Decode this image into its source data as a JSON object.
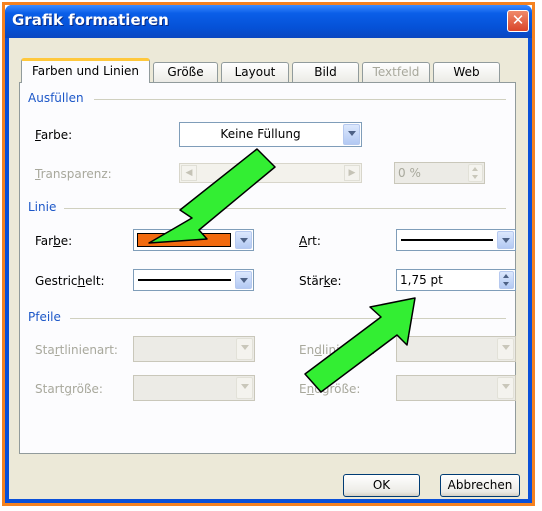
{
  "window": {
    "title": "Grafik formatieren",
    "close_glyph": "✕"
  },
  "tabs": [
    {
      "label": "Farben und Linien",
      "state": "active"
    },
    {
      "label": "Größe",
      "state": "normal"
    },
    {
      "label": "Layout",
      "state": "normal"
    },
    {
      "label": "Bild",
      "state": "normal"
    },
    {
      "label": "Textfeld",
      "state": "disabled"
    },
    {
      "label": "Web",
      "state": "normal"
    }
  ],
  "fill": {
    "section": "Ausfüllen",
    "color_label_key": "F",
    "color_label_rest": "arbe:",
    "color_value": "Keine Füllung",
    "transparency_label_key": "T",
    "transparency_label_rest": "ransparenz:",
    "transparency_value": "0 %"
  },
  "line": {
    "section": "Linie",
    "color_label_pre": "Far",
    "color_label_key": "b",
    "color_label_post": "e:",
    "color_value": "#f26b0f",
    "dashed_label_pre": "Gestric",
    "dashed_label_key": "h",
    "dashed_label_post": "elt:",
    "style_label_key": "A",
    "style_label_rest": "rt:",
    "weight_label_pre": "Stär",
    "weight_label_key": "k",
    "weight_label_post": "e:",
    "weight_value": "1,75 pt"
  },
  "arrows": {
    "section": "Pfeile",
    "start_style_pre": "Sta",
    "start_style_key": "r",
    "start_style_post": "tlinienart:",
    "start_size_pre": "Start",
    "start_size_key": "g",
    "start_size_post": "röße:",
    "end_style_pre": "En",
    "end_style_key": "d",
    "end_style_post": "linienart:",
    "end_size_pre": "E",
    "end_size_key": "n",
    "end_size_post": "dgröße:"
  },
  "buttons": {
    "ok": "OK",
    "cancel": "Abbrechen"
  },
  "colors": {
    "annotation_arrow": "#33ee33",
    "frame": "#f58220",
    "accent": "#1c57c8"
  }
}
